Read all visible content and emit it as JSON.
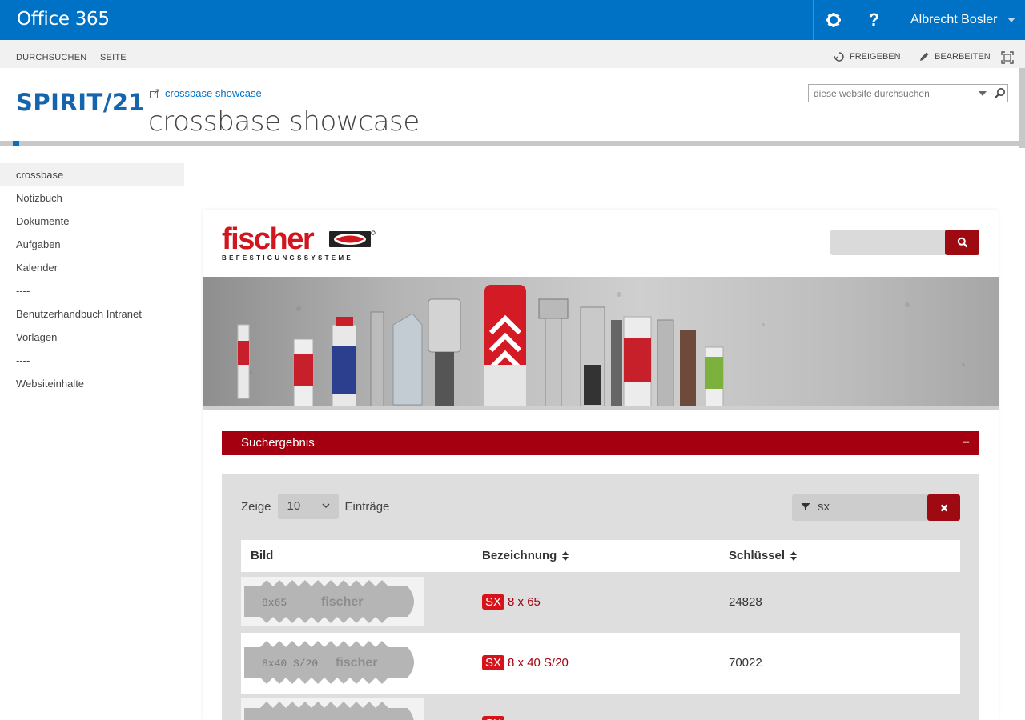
{
  "suitebar": {
    "brand": "Office 365",
    "user_name": "Albrecht Bosler"
  },
  "ribbon": {
    "tabs": [
      "DURCHSUCHEN",
      "SEITE"
    ],
    "share": "FREIGEBEN",
    "edit": "BEARBEITEN"
  },
  "header": {
    "logo": "SPIRIT/21",
    "breadcrumb": "crossbase showcase",
    "title": "crossbase showcase",
    "search_placeholder": "diese website durchsuchen"
  },
  "nav": [
    {
      "label": "crossbase",
      "selected": true
    },
    {
      "label": "Notizbuch"
    },
    {
      "label": "Dokumente"
    },
    {
      "label": "Aufgaben"
    },
    {
      "label": "Kalender"
    },
    {
      "label": "----"
    },
    {
      "label": "Benutzerhandbuch Intranet"
    },
    {
      "label": "Vorlagen"
    },
    {
      "label": "----"
    },
    {
      "label": "Websiteinhalte"
    }
  ],
  "content": {
    "brand_word": "fischer",
    "brand_sub": "BEFESTIGUNGSSYSTEME",
    "result_title": "Suchergebnis",
    "show_label": "Zeige",
    "show_value": "10",
    "entries_label": "Einträge",
    "filter_value": "sx",
    "columns": {
      "image": "Bild",
      "name": "Bezeichnung",
      "key": "Schlüssel"
    },
    "rows": [
      {
        "image_text": "8x65",
        "badge": "SX",
        "name": "8 x 65",
        "key": "24828"
      },
      {
        "image_text": "8x40 S/20",
        "badge": "SX",
        "name": "8 x 40 S/20",
        "key": "70022"
      },
      {
        "image_text": "",
        "badge": "SX",
        "name": "",
        "key": ""
      }
    ]
  },
  "colors": {
    "suitebar": "#0072c6",
    "accent_red": "#a50010",
    "badge_red": "#d6121a"
  }
}
